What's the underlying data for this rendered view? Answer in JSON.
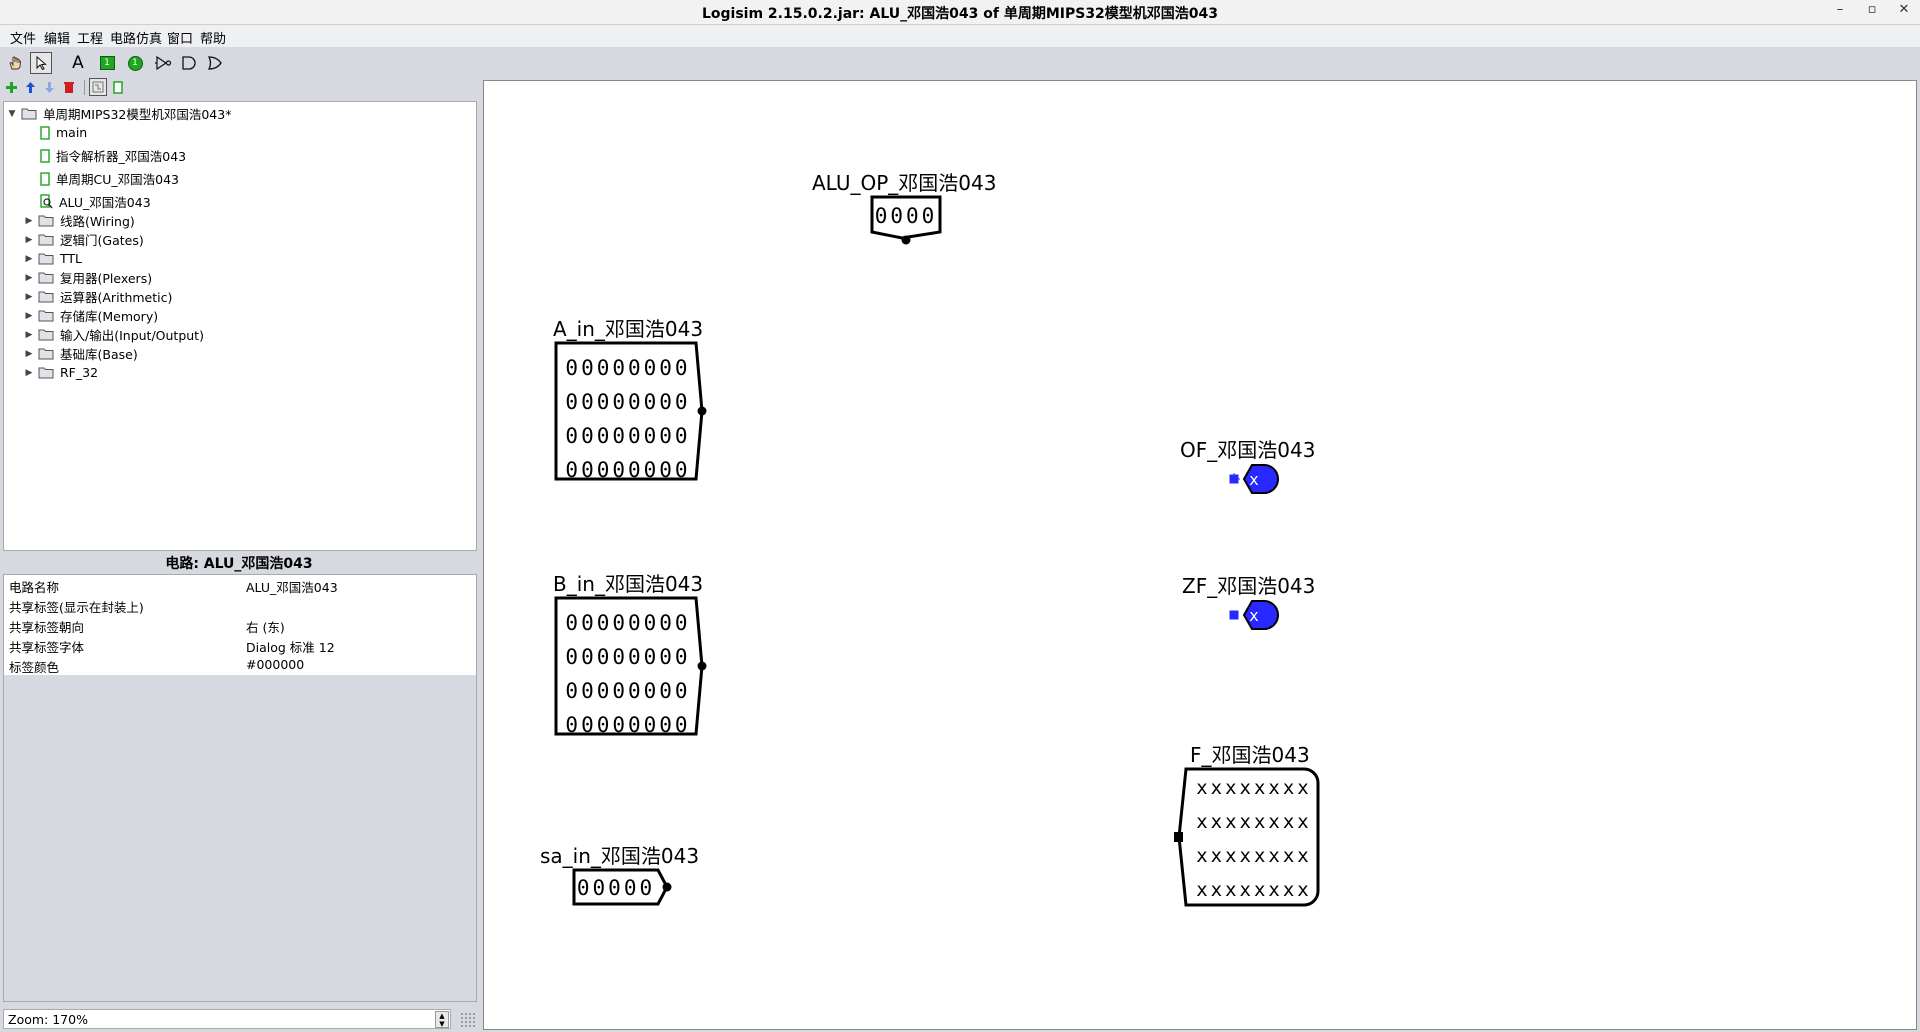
{
  "window": {
    "title": "Logisim 2.15.0.2.jar: ALU_邓国浩043 of 单周期MIPS32模型机邓国浩043",
    "controls": [
      "–",
      "▫",
      "✕"
    ]
  },
  "menubar": {
    "items": [
      "文件",
      "编辑",
      "工程",
      "电路仿真",
      "窗口",
      "帮助"
    ]
  },
  "toolbar": {
    "tools": [
      "hand-poke-tool",
      "select-arrow-tool",
      "text-tool",
      "input-pin-tool",
      "output-pin-tool",
      "not-gate-tool",
      "and-gate-tool",
      "or-gate-tool"
    ],
    "text_tool_label": "A",
    "input_pin_glyph": "1",
    "output_pin_glyph": "1",
    "project_tools": [
      "add-circuit",
      "move-up",
      "move-down",
      "delete-circuit",
      "layout-view",
      "appearance-view"
    ]
  },
  "explorer": {
    "root": "单周期MIPS32模型机邓国浩043*",
    "circuits": [
      "main",
      "指令解析器_邓国浩043",
      "单周期CU_邓国浩043",
      "ALU_邓国浩043"
    ],
    "libraries": [
      "线路(Wiring)",
      "逻辑门(Gates)",
      "TTL",
      "复用器(Plexers)",
      "运算器(Arithmetic)",
      "存储库(Memory)",
      "输入/输出(Input/Output)",
      "基础库(Base)",
      "RF_32"
    ]
  },
  "attributes": {
    "title": "电路: ALU_邓国浩043",
    "rows": [
      {
        "key": "电路名称",
        "value": "ALU_邓国浩043"
      },
      {
        "key": "共享标签(显示在封装上)",
        "value": ""
      },
      {
        "key": "共享标签朝向",
        "value": "右 (东)"
      },
      {
        "key": "共享标签字体",
        "value": "Dialog 标准 12"
      },
      {
        "key": "标签颜色",
        "value": "#000000"
      }
    ]
  },
  "zoom": {
    "label": "Zoom: 170%"
  },
  "canvas": {
    "components": [
      {
        "label": "ALU_OP_邓国浩043",
        "type": "input-pin",
        "width_bits": 4,
        "value_rows": [
          "0000"
        ]
      },
      {
        "label": "A_in_邓国浩043",
        "type": "input-pin",
        "width_bits": 32,
        "value_rows": [
          "00000000",
          "00000000",
          "00000000",
          "00000000"
        ]
      },
      {
        "label": "B_in_邓国浩043",
        "type": "input-pin",
        "width_bits": 32,
        "value_rows": [
          "00000000",
          "00000000",
          "00000000",
          "00000000"
        ]
      },
      {
        "label": "sa_in_邓国浩043",
        "type": "input-pin",
        "width_bits": 5,
        "value_rows": [
          "00000"
        ]
      },
      {
        "label": "OF_邓国浩043",
        "type": "output-pin",
        "width_bits": 1,
        "value_rows": [
          "x"
        ]
      },
      {
        "label": "ZF_邓国浩043",
        "type": "output-pin",
        "width_bits": 1,
        "value_rows": [
          "x"
        ]
      },
      {
        "label": "F_邓国浩043",
        "type": "output-pin",
        "width_bits": 32,
        "value_rows": [
          "xxxxxxxx",
          "xxxxxxxx",
          "xxxxxxxx",
          "xxxxxxxx"
        ]
      }
    ]
  },
  "colors": {
    "canvas_bg": "#ffffff",
    "panel_bg": "#d6d9df",
    "unknown_value_fill": "#2828ff",
    "wire_black": "#000000",
    "toolbar_green": "#1fa81f",
    "toolbar_blue": "#1f4fd8",
    "toolbar_red": "#d01f1f"
  }
}
